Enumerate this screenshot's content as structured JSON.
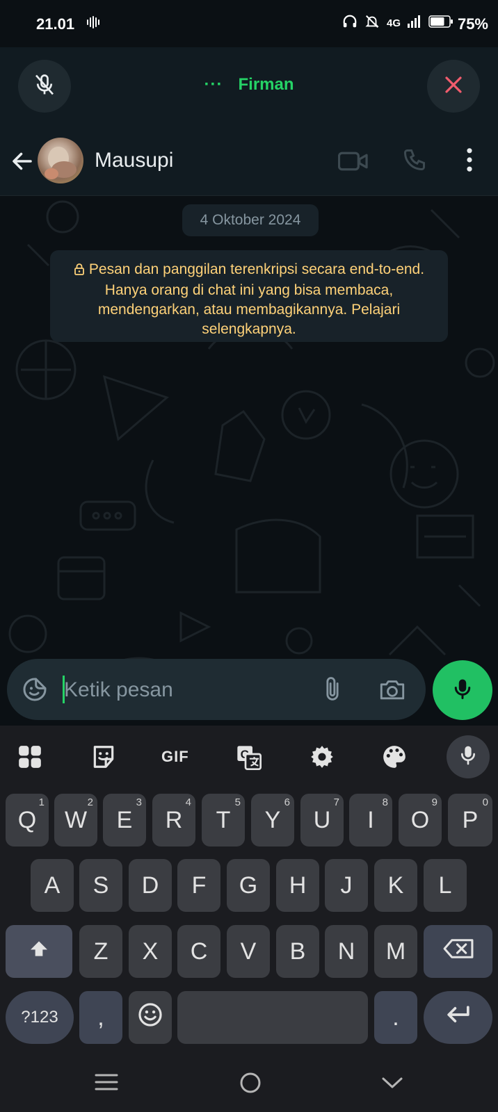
{
  "status_bar": {
    "time": "21.01",
    "network": "4G",
    "battery": "75%",
    "battery_level": 0.75
  },
  "call_bar": {
    "dots": "···",
    "caller_name": "Firman",
    "mute_icon": "mic-off-icon",
    "end_icon": "close-icon",
    "accent_color": "#25d366",
    "end_color": "#f15c6d"
  },
  "chat_header": {
    "contact_name": "Mausupi",
    "icons": [
      "back-arrow-icon",
      "video-call-icon",
      "voice-call-icon",
      "more-vert-icon"
    ]
  },
  "chat": {
    "date_chip": "4 Oktober 2024",
    "system_message": "Pesan dan panggilan terenkripsi secara end-to-end. Hanya orang di chat ini yang bisa membaca, mendengarkan, atau membagikannya. Pelajari selengkapnya.",
    "system_message_color": "#ffd279"
  },
  "composer": {
    "placeholder": "Ketik pesan",
    "icons": [
      "sticker-icon",
      "attach-icon",
      "camera-icon",
      "mic-icon"
    ],
    "send_color": "#21c063"
  },
  "keyboard": {
    "toolbar": {
      "gif_label": "GIF",
      "icons": [
        "apps-grid-icon",
        "sticker-icon",
        "gif-icon",
        "translate-icon",
        "settings-icon",
        "palette-icon",
        "mic-icon"
      ]
    },
    "row1": [
      {
        "key": "Q",
        "hint": "1"
      },
      {
        "key": "W",
        "hint": "2"
      },
      {
        "key": "E",
        "hint": "3"
      },
      {
        "key": "R",
        "hint": "4"
      },
      {
        "key": "T",
        "hint": "5"
      },
      {
        "key": "Y",
        "hint": "6"
      },
      {
        "key": "U",
        "hint": "7"
      },
      {
        "key": "I",
        "hint": "8"
      },
      {
        "key": "O",
        "hint": "9"
      },
      {
        "key": "P",
        "hint": "0"
      }
    ],
    "row2": [
      "A",
      "S",
      "D",
      "F",
      "G",
      "H",
      "J",
      "K",
      "L"
    ],
    "row3": [
      "Z",
      "X",
      "C",
      "V",
      "B",
      "N",
      "M"
    ],
    "symbols_label": "?123",
    "comma_label": ",",
    "period_label": ".",
    "special_icons": [
      "shift-icon",
      "backspace-icon",
      "emoji-icon",
      "enter-icon"
    ]
  },
  "nav_bar": {
    "icons": [
      "recents-icon",
      "home-icon",
      "back-icon"
    ]
  }
}
